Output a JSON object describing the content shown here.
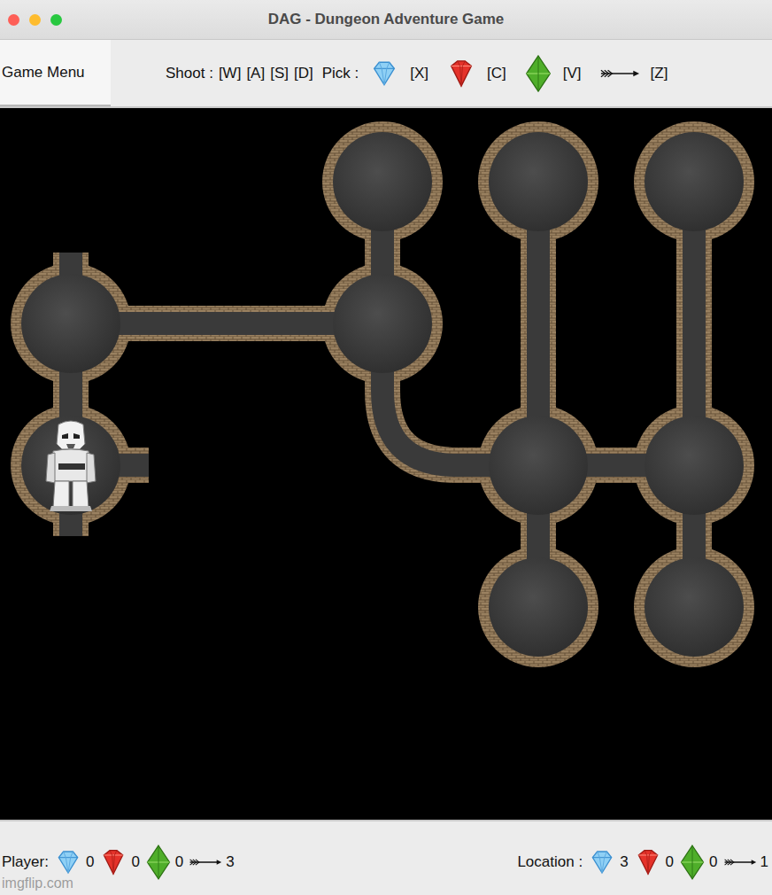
{
  "window": {
    "title": "DAG - Dungeon Adventure Game"
  },
  "menu": {
    "label": "Game Menu",
    "selected": true
  },
  "controls": {
    "shoot_label": "Shoot :",
    "shoot_keys": [
      "[W]",
      "[A]",
      "[S]",
      "[D]"
    ],
    "pick_label": "Pick :",
    "pick_items": [
      {
        "kind": "diamond",
        "key": "[X]"
      },
      {
        "kind": "ruby",
        "key": "[C]"
      },
      {
        "kind": "emerald",
        "key": "[V]"
      },
      {
        "kind": "arrow",
        "key": "[Z]"
      }
    ]
  },
  "dungeon": {
    "rooms": [
      {
        "row": 1,
        "col": 0,
        "player": false,
        "open": [
          "n"
        ]
      },
      {
        "row": 2,
        "col": 0,
        "player": true,
        "open": [
          "e",
          "s"
        ]
      },
      {
        "row": 0,
        "col": 2,
        "player": false,
        "open": []
      },
      {
        "row": 1,
        "col": 2,
        "player": false,
        "open": []
      },
      {
        "row": 0,
        "col": 3,
        "player": false,
        "open": []
      },
      {
        "row": 2,
        "col": 3,
        "player": false,
        "open": []
      },
      {
        "row": 3,
        "col": 3,
        "player": false,
        "open": []
      },
      {
        "row": 0,
        "col": 4,
        "player": false,
        "open": []
      },
      {
        "row": 2,
        "col": 4,
        "player": false,
        "open": []
      },
      {
        "row": 3,
        "col": 4,
        "player": false,
        "open": []
      }
    ],
    "passages": [
      {
        "from": [
          1,
          0
        ],
        "to": [
          2,
          0
        ]
      },
      {
        "from": [
          1,
          0
        ],
        "to": [
          1,
          2
        ]
      },
      {
        "from": [
          1,
          2
        ],
        "to": [
          0,
          2
        ]
      },
      {
        "from": [
          1,
          2
        ],
        "to": [
          2,
          3
        ]
      },
      {
        "from": [
          0,
          3
        ],
        "to": [
          2,
          3
        ]
      },
      {
        "from": [
          2,
          3
        ],
        "to": [
          2,
          4
        ]
      },
      {
        "from": [
          2,
          3
        ],
        "to": [
          3,
          3
        ]
      },
      {
        "from": [
          0,
          4
        ],
        "to": [
          2,
          4
        ]
      },
      {
        "from": [
          2,
          4
        ],
        "to": [
          3,
          4
        ]
      }
    ]
  },
  "status": {
    "player": {
      "label": "Player:",
      "counts": [
        {
          "kind": "diamond",
          "value": "0"
        },
        {
          "kind": "ruby",
          "value": "0"
        },
        {
          "kind": "emerald",
          "value": "0"
        },
        {
          "kind": "arrow",
          "value": "3"
        }
      ]
    },
    "location": {
      "label": "Location :",
      "counts": [
        {
          "kind": "diamond",
          "value": "3"
        },
        {
          "kind": "ruby",
          "value": "0"
        },
        {
          "kind": "emerald",
          "value": "0"
        },
        {
          "kind": "arrow",
          "value": "1"
        }
      ]
    }
  },
  "watermark": "imgflip.com"
}
